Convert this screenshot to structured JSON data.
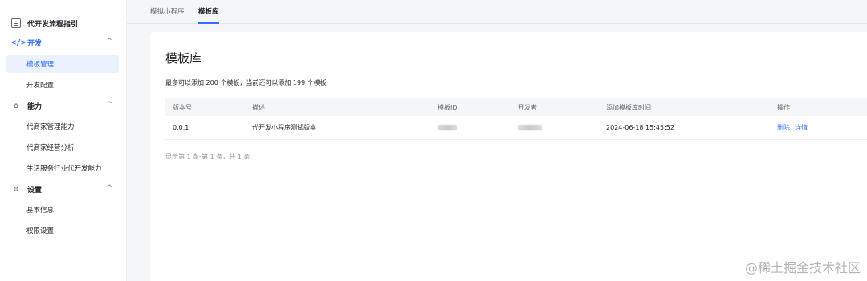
{
  "sidebar": {
    "top_item": {
      "label": "代开发流程指引",
      "icon": "document-icon"
    },
    "groups": [
      {
        "label": "开发",
        "icon": "code-icon",
        "items": [
          "模板管理",
          "开发配置"
        ]
      },
      {
        "label": "能力",
        "icon": "bag-icon",
        "items": [
          "代商家管理能力",
          "代商家经营分析",
          "生活服务行业代开发能力"
        ]
      },
      {
        "label": "设置",
        "icon": "gear-icon",
        "items": [
          "基本信息",
          "权限设置"
        ]
      }
    ],
    "chevron": "^",
    "selected_item": "模板管理"
  },
  "tabs": [
    {
      "label": "模拟小程序"
    },
    {
      "label": "模板库",
      "active": true
    }
  ],
  "main": {
    "title": "模板库",
    "hint": "最多可以添加 200 个模板，当前还可以添加 199 个模板",
    "columns": [
      "版本号",
      "描述",
      "模板ID",
      "开发者",
      "添加模板库时间",
      "操作"
    ],
    "rows": [
      {
        "version": "0.0.1",
        "description": "代开发小程序测试版本",
        "template_id": "",
        "developer": "",
        "added_time": "2024-06-18 15:45:52",
        "actions": [
          "删除",
          "详情"
        ]
      }
    ],
    "pagination": "显示第 1 条-第 1 条，共 1 条"
  },
  "watermark": "@稀土掘金技术社区",
  "colors": {
    "accent": "#3370ff",
    "selected_bg": "#ebf1ff",
    "page_bg": "#f5f6f7"
  }
}
